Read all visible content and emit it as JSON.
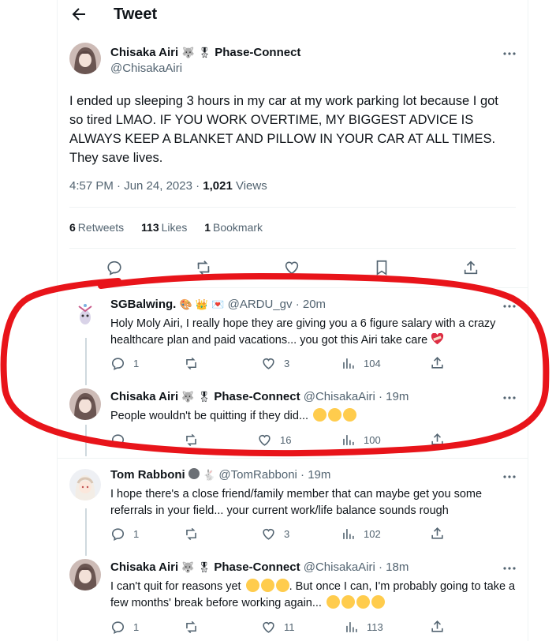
{
  "header": {
    "title": "Tweet"
  },
  "tweet": {
    "author_name": "Chisaka Airi",
    "author_suffix": "Phase-Connect",
    "author_handle": "@ChisakaAiri",
    "text": "I ended up sleeping 3 hours in my car at my work parking lot because I got so tired LMAO. IF YOU WORK OVERTIME, MY BIGGEST ADVICE IS ALWAYS KEEP A BLANKET AND PILLOW IN YOUR CAR AT ALL TIMES. They save lives.",
    "timestamp": "4:57 PM · Jun 24, 2023 · ",
    "views_count": "1,021",
    "views_label": " Views",
    "retweets_count": "6",
    "retweets_label": "Retweets",
    "likes_count": "113",
    "likes_label": "Likes",
    "bookmarks_count": "1",
    "bookmarks_label": "Bookmark"
  },
  "replies": [
    {
      "name": "SGBalwing.",
      "handle": "@ARDU_gv",
      "time": "· 20m",
      "text": "Holy Moly Airi, I really hope they are giving you a 6 figure salary with a crazy healthcare plan and paid vacations... you got this Airi take care",
      "replies": "1",
      "retweets": "",
      "likes": "3",
      "views": "104"
    },
    {
      "name": "Chisaka Airi",
      "suffix": "Phase-Connect",
      "handle": "@ChisakaAiri",
      "time": "· 19m",
      "text": "People wouldn't be quitting if they did...",
      "replies": "",
      "retweets": "",
      "likes": "16",
      "views": "100"
    },
    {
      "name": "Tom Rabboni",
      "handle": "@TomRabboni",
      "time": "· 19m",
      "text": "I hope there's a close friend/family member that can maybe get you some referrals in your field... your current work/life balance sounds rough",
      "replies": "1",
      "retweets": "",
      "likes": "3",
      "views": "102"
    },
    {
      "name": "Chisaka Airi",
      "suffix": "Phase-Connect",
      "handle": "@ChisakaAiri",
      "time": "· 18m",
      "text_a": "I can't quit for reasons yet",
      "text_b": ". But once I can, I'm probably going to take a few months' break before working again...",
      "replies": "1",
      "retweets": "",
      "likes": "11",
      "views": "113"
    }
  ],
  "colors": {
    "annotation_circle": "#e8141a",
    "secondary_text": "#536471",
    "primary_text": "#0f1419"
  }
}
